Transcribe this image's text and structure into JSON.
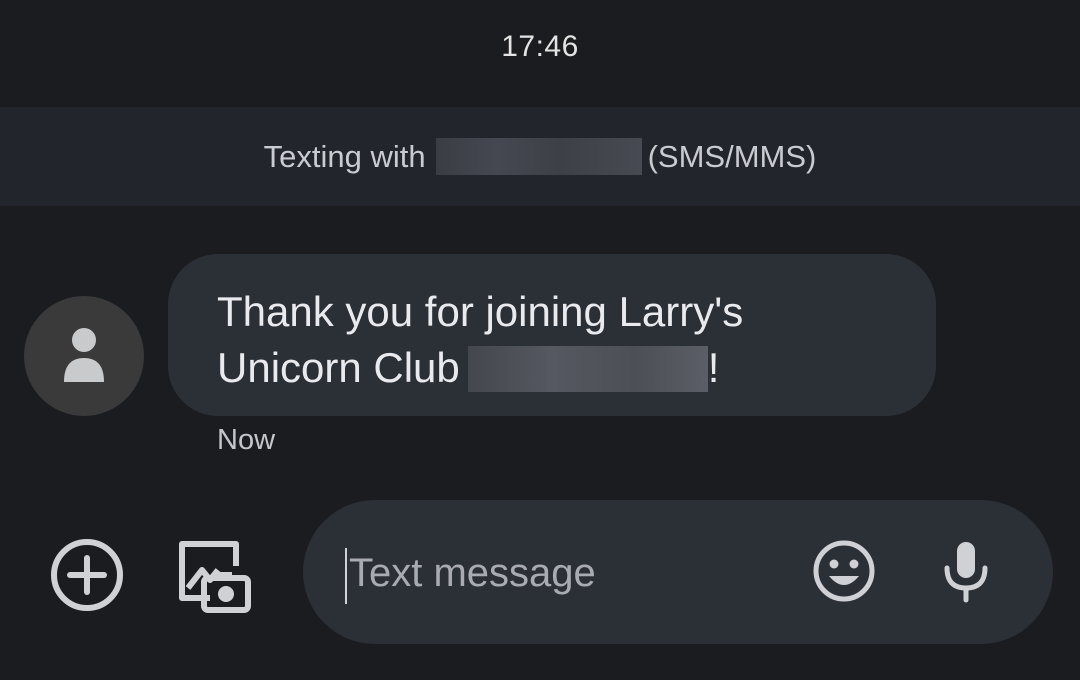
{
  "status_bar": {
    "time": "17:46"
  },
  "banner": {
    "prefix": "Texting with",
    "suffix": "(SMS/MMS)"
  },
  "message": {
    "line1": "Thank you for joining Larry's",
    "line2_prefix": "Unicorn Club",
    "line2_suffix": "!",
    "timestamp": "Now"
  },
  "compose": {
    "placeholder": "Text message"
  },
  "icons": {
    "avatar": "person-icon",
    "add": "add-circle-icon",
    "gallery": "photo-camera-icon",
    "emoji": "emoji-icon",
    "mic": "microphone-icon"
  },
  "colors": {
    "background": "#1b1c1f",
    "banner": "#22252b",
    "bubble": "#2b2f36",
    "avatar": "#3a3a3b",
    "icon": "#cfd1d5"
  }
}
